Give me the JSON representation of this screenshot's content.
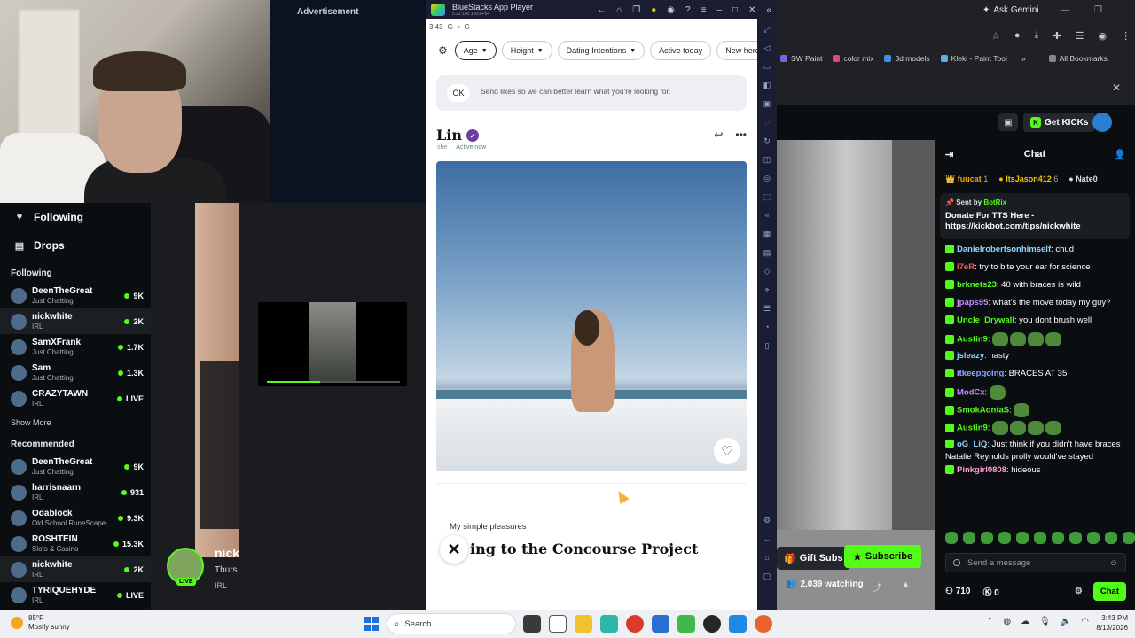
{
  "advertisement": "Advertisement",
  "kick_sidebar": {
    "nav": [
      {
        "label": "Following",
        "icon": "heart-icon"
      },
      {
        "label": "Drops",
        "icon": "drops-icon"
      }
    ],
    "following_title": "Following",
    "following": [
      {
        "name": "DeenTheGreat",
        "category": "Just Chatting",
        "viewers": "9K"
      },
      {
        "name": "nickwhite",
        "category": "IRL",
        "viewers": "2K"
      },
      {
        "name": "SamXFrank",
        "category": "Just Chatting",
        "viewers": "1.7K"
      },
      {
        "name": "Sam",
        "category": "Just Chatting",
        "viewers": "1.3K"
      },
      {
        "name": "CRAZYTAWN",
        "category": "IRL",
        "viewers": "LIVE"
      }
    ],
    "show_more": "Show More",
    "recommended_title": "Recommended",
    "recommended": [
      {
        "name": "DeenTheGreat",
        "category": "Just Chatting",
        "viewers": "9K"
      },
      {
        "name": "harrisnaarn",
        "category": "IRL",
        "viewers": "931"
      },
      {
        "name": "Odablock",
        "category": "Old School RuneScape",
        "viewers": "9.3K"
      },
      {
        "name": "ROSHTEIN",
        "category": "Slots & Casino",
        "viewers": "15.3K"
      },
      {
        "name": "nickwhite",
        "category": "IRL",
        "viewers": "2K"
      },
      {
        "name": "TYRIQUEHYDE",
        "category": "IRL",
        "viewers": "LIVE"
      }
    ]
  },
  "stream_info": {
    "name": "nick",
    "title": "Thurs",
    "category": "IRL",
    "live": "LIVE"
  },
  "bluestacks": {
    "title": "BlueStacks App Player",
    "version": "5.22.166.1003 P64"
  },
  "dating_app": {
    "time": "3:43",
    "filters": [
      "Age",
      "Height",
      "Dating Intentions",
      "Active today",
      "New here"
    ],
    "notice_ok": "OK",
    "notice_text": "Send likes so we can better learn what you're looking for.",
    "profile_name": "Lin",
    "pronoun": "she",
    "status": "Active now",
    "prompt_question": "My simple pleasures",
    "prompt_answer": "ing to the Concourse Project"
  },
  "browser": {
    "ask_gemini": "Ask Gemini",
    "bookmarks": [
      "SW Paint",
      "color mix",
      "3d models",
      "Kleki - Paint Tool"
    ],
    "all_bookmarks": "All Bookmarks"
  },
  "kick_header": {
    "get_kicks": "Get KICKs"
  },
  "chat": {
    "title": "Chat",
    "gifters": [
      {
        "name": "fuucat",
        "count": "1"
      },
      {
        "name": "ItsJason412",
        "count": "6"
      },
      {
        "name": "Nate0",
        "count": ""
      }
    ],
    "pinned_by_label": "Sent by",
    "pinned_by": "BotRix",
    "pinned_text": "Donate For TTS Here -",
    "pinned_link": "https://kickbot.com/tips/nickwhite",
    "messages": [
      {
        "user": "Danielrobertsonhimself",
        "text": "chud",
        "color": "#8fd3ff"
      },
      {
        "user": "i7eR",
        "text": "try to bite your ear for science",
        "color": "#ff5a5a"
      },
      {
        "user": "brknets23",
        "text": "40 with braces is wild",
        "color": "#53fc18"
      },
      {
        "user": "jpaps95",
        "text": "what's the move today my guy?",
        "color": "#c48cff"
      },
      {
        "user": "Uncle_Drywall",
        "text": "you dont brush well",
        "color": "#53fc18"
      },
      {
        "user": "Austin9",
        "text": "",
        "color": "#53fc18"
      },
      {
        "user": "jsleazy",
        "text": "nasty",
        "color": "#8fd3ff"
      },
      {
        "user": "itkeepgoing",
        "text": "BRACES AT 35",
        "color": "#8fa7ff"
      },
      {
        "user": "ModCx",
        "text": "",
        "color": "#c48cff"
      },
      {
        "user": "SmokAontaS",
        "text": "",
        "color": "#53fc18"
      },
      {
        "user": "Austin9",
        "text": "",
        "color": "#53fc18"
      },
      {
        "user": "oG_LiQ",
        "text": "Just think if you didn't have braces Natalie Reynolds prolly would've stayed",
        "color": "#8fd3ff"
      },
      {
        "user": "Pinkgirl0808",
        "text": "hideous",
        "color": "#ff9ad5"
      }
    ],
    "input_placeholder": "Send a message",
    "points": "710",
    "kick_points": "0",
    "send": "Chat"
  },
  "stream_bar": {
    "gift_subs": "Gift Subs",
    "subscribe": "Subscribe",
    "watching": "2,039 watching"
  },
  "taskbar": {
    "temp": "85°F",
    "weather": "Mostly sunny",
    "search": "Search",
    "time": "3:43 PM",
    "date": "8/13/2026"
  }
}
